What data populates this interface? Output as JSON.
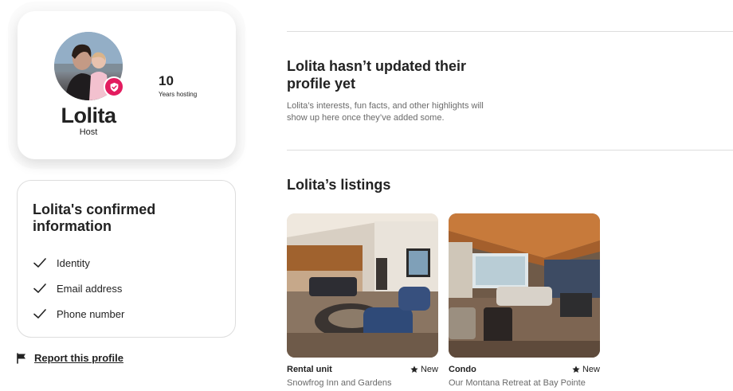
{
  "profile": {
    "name": "Lolita",
    "role": "Host",
    "stat_value": "10",
    "stat_label": "Years hosting",
    "badge_color": "#e31c5f"
  },
  "confirmed": {
    "title": "Lolita's confirmed information",
    "items": [
      "Identity",
      "Email address",
      "Phone number"
    ],
    "icon": "check-icon"
  },
  "report": {
    "label": "Report this profile",
    "icon": "flag-icon"
  },
  "empty_state": {
    "title": "Lolita hasn’t updated their profile yet",
    "description": "Lolita’s interests, fun facts, and other highlights will show up here once they’ve added some."
  },
  "listings": {
    "title": "Lolita’s listings",
    "items": [
      {
        "type": "Rental unit",
        "rating": "New",
        "name": "Snowfrog Inn and Gardens"
      },
      {
        "type": "Condo",
        "rating": "New",
        "name": "Our Montana Retreat at Bay Pointe"
      }
    ]
  }
}
